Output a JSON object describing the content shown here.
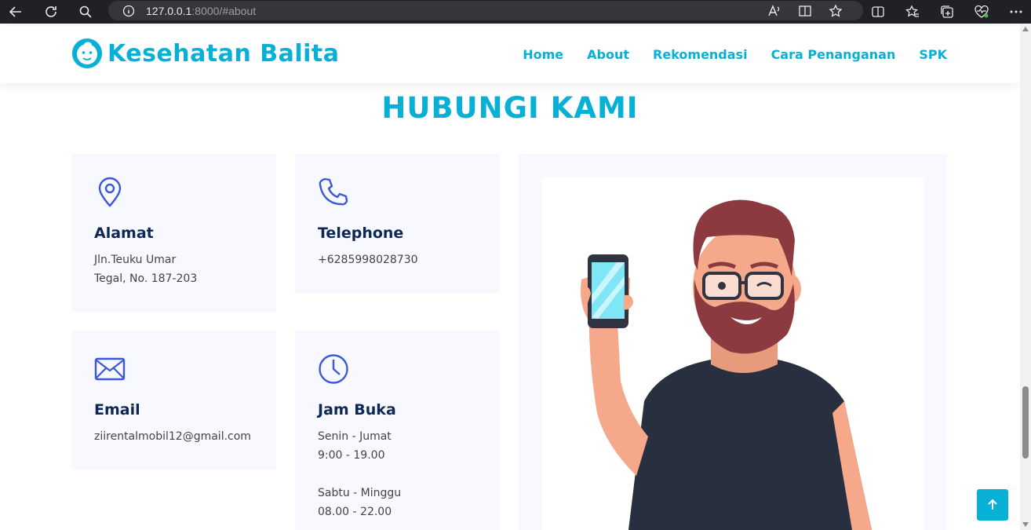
{
  "browser": {
    "url_host": "127.0.0.1",
    "url_rest": ":8000/#about"
  },
  "brand": {
    "name": "Kesehatan Balita",
    "accent": "#08b0d6",
    "heading_color": "#0d2857",
    "icon_color": "#3b59d6"
  },
  "nav": {
    "items": [
      "Home",
      "About",
      "Rekomendasi",
      "Cara Penanganan",
      "SPK"
    ]
  },
  "section": {
    "title": "HUBUNGI KAMI"
  },
  "contact": {
    "address": {
      "icon": "location-pin-icon",
      "title": "Alamat",
      "line1": "Jln.Teuku Umar",
      "line2": "Tegal, No. 187-203"
    },
    "phone": {
      "icon": "phone-icon",
      "title": "Telephone",
      "line1": "+6285998028730"
    },
    "email": {
      "icon": "envelope-icon",
      "title": "Email",
      "line1": "ziirentalmobil12@gmail.com"
    },
    "hours": {
      "icon": "clock-icon",
      "title": "Jam Buka",
      "line1": "Senin - Jumat",
      "line2": "9:00 - 19.00",
      "line3": "Sabtu - Minggu",
      "line4": "08.00 - 22.00"
    }
  },
  "illustration": {
    "icon": "man-holding-phone-illustration"
  },
  "scroll_top": {
    "icon": "arrow-up-icon"
  }
}
